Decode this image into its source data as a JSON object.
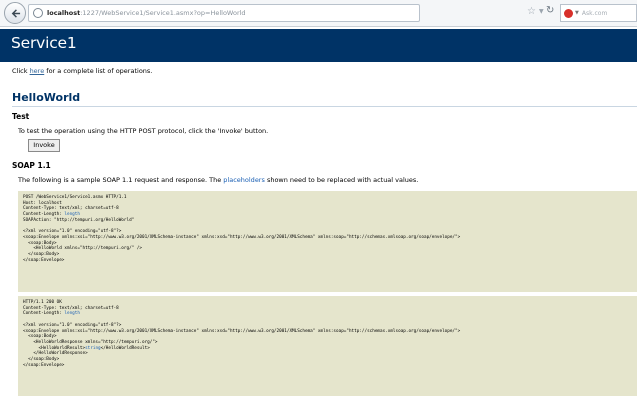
{
  "browser": {
    "url_host": "localhost",
    "url_path": ":1227/WebService1/Service1.asmx?op=HelloWorld",
    "search_placeholder": "Ask.com"
  },
  "page": {
    "title": "Service1",
    "intro_before": "Click ",
    "intro_link": "here",
    "intro_after": " for a complete list of operations.",
    "operation": "HelloWorld"
  },
  "test": {
    "heading": "Test",
    "description": "To test the operation using the HTTP POST protocol, click the 'Invoke' button.",
    "invoke_label": "Invoke"
  },
  "soap": {
    "heading": "SOAP 1.1",
    "desc_before": "The following is a sample SOAP 1.1 request and response.  The ",
    "desc_link": "placeholders",
    "desc_after": " shown need to be replaced with actual values.",
    "request": {
      "l1": "POST /WebService1/Service1.asmx HTTP/1.1",
      "l2": "Host: localhost",
      "l3": "Content-Type: text/xml; charset=utf-8",
      "l4_prefix": "Content-Length: ",
      "l4_ph": "length",
      "l5": "SOAPAction: \"http://tempuri.org/HelloWorld\"",
      "l7": "<?xml version=\"1.0\" encoding=\"utf-8\"?>",
      "l8": "<soap:Envelope xmlns:xsi=\"http://www.w3.org/2001/XMLSchema-instance\" xmlns:xsd=\"http://www.w3.org/2001/XMLSchema\" xmlns:soap=\"http://schemas.xmlsoap.org/soap/envelope/\">",
      "l9": "  <soap:Body>",
      "l10": "    <HelloWorld xmlns=\"http://tempuri.org/\" />",
      "l11": "  </soap:Body>",
      "l12": "</soap:Envelope>"
    },
    "response": {
      "l1": "HTTP/1.1 200 OK",
      "l2": "Content-Type: text/xml; charset=utf-8",
      "l3_prefix": "Content-Length: ",
      "l3_ph": "length",
      "l5": "<?xml version=\"1.0\" encoding=\"utf-8\"?>",
      "l6": "<soap:Envelope xmlns:xsi=\"http://www.w3.org/2001/XMLSchema-instance\" xmlns:xsd=\"http://www.w3.org/2001/XMLSchema\" xmlns:soap=\"http://schemas.xmlsoap.org/soap/envelope/\">",
      "l7": "  <soap:Body>",
      "l8": "    <HelloWorldResponse xmlns=\"http://tempuri.org/\">",
      "l9_prefix": "      <HelloWorldResult>",
      "l9_ph": "string",
      "l9_suffix": "</HelloWorldResult>",
      "l10": "    </HelloWorldResponse>",
      "l11": "  </soap:Body>",
      "l12": "</soap:Envelope>"
    }
  },
  "colors": {
    "header_bg": "#003366",
    "operation_title": "#003366",
    "code_bg": "#e5e5cc",
    "link": "#336699",
    "placeholder": "#1a5fb4"
  },
  "icons": [
    "back-arrow-icon",
    "globe-icon",
    "star-icon",
    "dropdown-icon",
    "reload-icon",
    "ask-search-icon"
  ]
}
